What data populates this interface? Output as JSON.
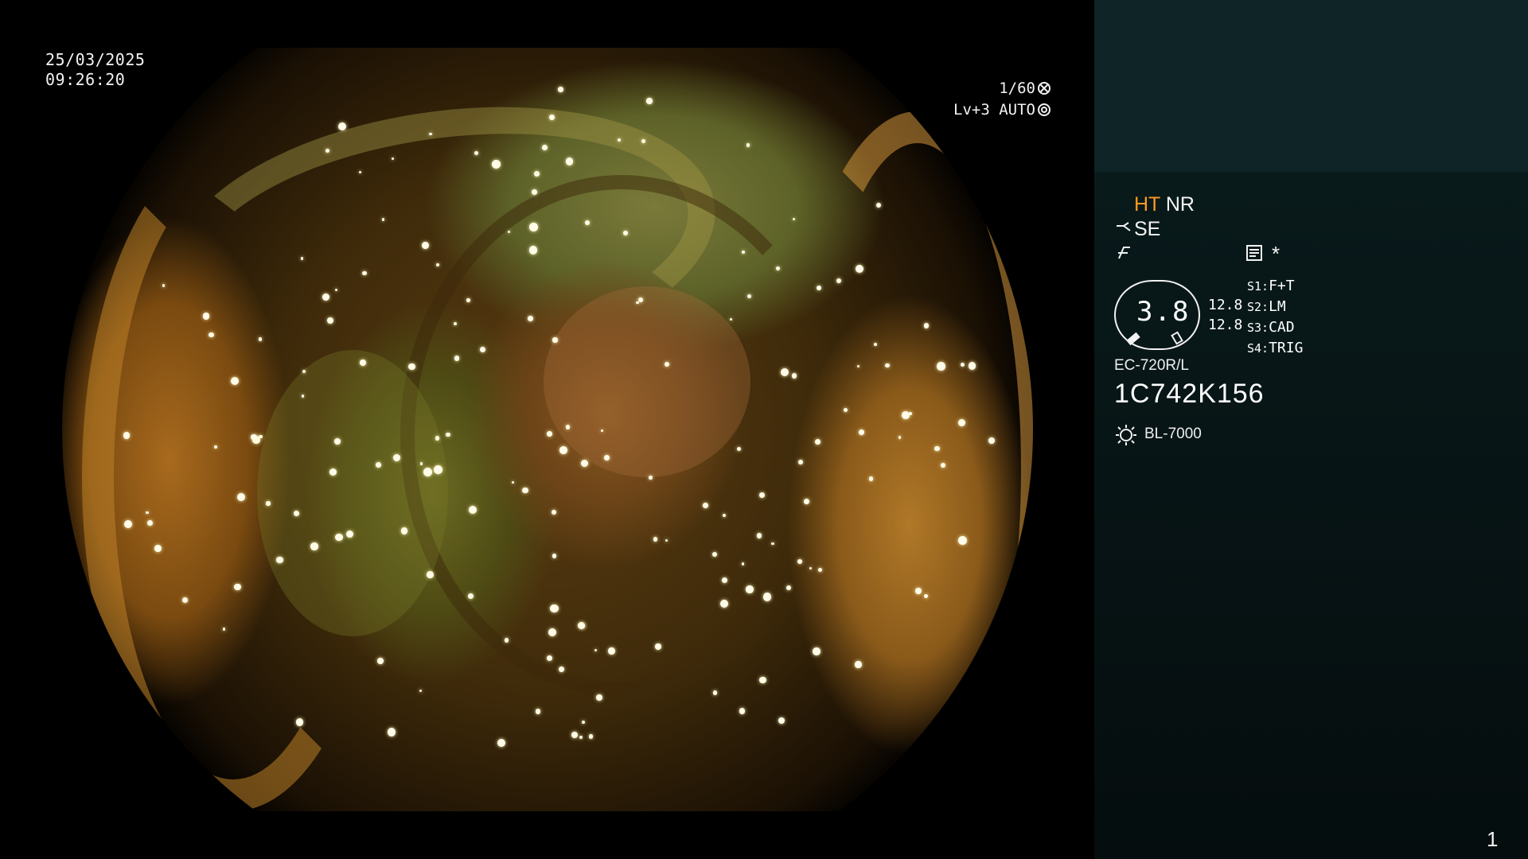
{
  "overlay": {
    "date": "25/03/2025",
    "time": "09:26:20",
    "shutter": "1/60",
    "level": "Lv+3",
    "exposure_mode": "AUTO",
    "shutter_icon": "shutter-icon",
    "iris_icon": "iris-icon"
  },
  "panel": {
    "ht": "HT",
    "nr": "NR",
    "se": "SE",
    "asterisk": "*",
    "scope_icon": "scope-angle-icon",
    "freeze_icon": "freeze-icon",
    "memo_icon": "memo-icon",
    "gauge_value": "3.8",
    "side_values": [
      "12.8",
      "12.8"
    ],
    "switches": [
      {
        "key": "S1:",
        "value": "F+T"
      },
      {
        "key": "S2:",
        "value": "LM"
      },
      {
        "key": "S3:",
        "value": "CAD"
      },
      {
        "key": "S4:",
        "value": "TRIG"
      }
    ],
    "model": "EC-720R/L",
    "serial": "1C742K156",
    "light_icon": "light-source-icon",
    "light_source": "BL-7000",
    "page_number": "1"
  },
  "colors": {
    "accent": "#ff9a1f",
    "panel_top": "#0e2426",
    "panel_bottom": "#091a1b"
  }
}
